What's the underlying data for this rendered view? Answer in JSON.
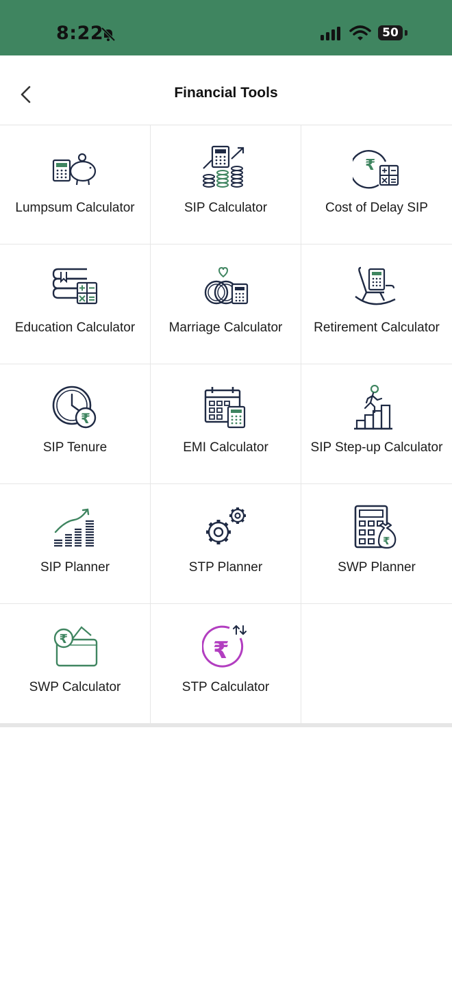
{
  "status_bar": {
    "time": "8:22",
    "battery": "50"
  },
  "header": {
    "title": "Financial Tools"
  },
  "tools": [
    {
      "label": "Lumpsum Calculator"
    },
    {
      "label": "SIP Calculator"
    },
    {
      "label": "Cost of Delay SIP"
    },
    {
      "label": "Education Calculator"
    },
    {
      "label": "Marriage Calculator"
    },
    {
      "label": "Retirement Calculator"
    },
    {
      "label": "SIP Tenure"
    },
    {
      "label": "EMI Calculator"
    },
    {
      "label": "SIP Step-up Calculator"
    },
    {
      "label": "SIP Planner"
    },
    {
      "label": "STP Planner"
    },
    {
      "label": "SWP Planner"
    },
    {
      "label": "SWP Calculator"
    },
    {
      "label": "STP Calculator"
    }
  ],
  "colors": {
    "status_bar": "#3f8560",
    "icon_dark": "#1f2a44",
    "icon_accent": "#3f8560",
    "icon_purple": "#b23ec0"
  }
}
